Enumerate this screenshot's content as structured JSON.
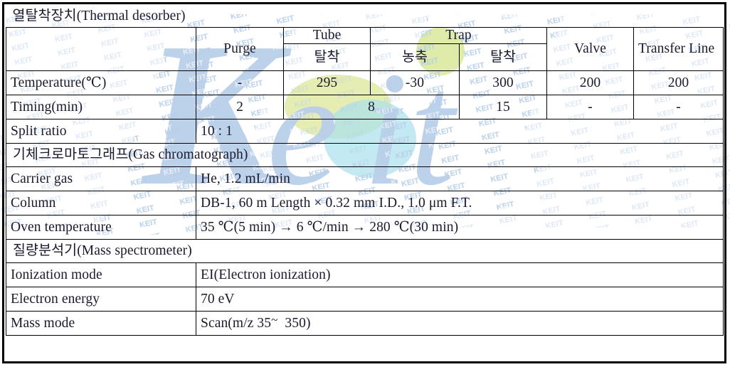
{
  "document": {
    "kind": "analytical-conditions-table",
    "watermark_text": "KEIT",
    "watermark_logo_text": "Keit",
    "colors": {
      "watermark_blue": "#b3cbe6",
      "watermark_green": "#d8e89a",
      "watermark_cyan": "#a9e0ee",
      "border": "#000000",
      "text": "#1a1a2e"
    }
  },
  "sections": {
    "thermal_desorber": "열탈착장치(Thermal desorber)",
    "gas_chromatograph": "기체크로마토그래프(Gas chromatograph)",
    "mass_spectrometer": "질량분석기(Mass spectrometer)"
  },
  "header": {
    "blank": "",
    "purge": "Purge",
    "tube": "Tube",
    "trap": "Trap",
    "valve": "Valve",
    "transfer_line": "Transfer Line",
    "tube_sub": "탈착",
    "trap_sub_1": "농축",
    "trap_sub_2": "탈착"
  },
  "rows": {
    "temperature": {
      "label": "Temperature(℃)",
      "purge": "-",
      "tube_desorb": "295",
      "trap_concentrate": "-30",
      "trap_desorb": "300",
      "valve": "200",
      "transfer_line": "200"
    },
    "timing": {
      "label": "Timing(min)",
      "purge": "2",
      "tube_and_trap_concentrate": "8",
      "trap_desorb": "15",
      "valve": "-",
      "transfer_line": "-"
    },
    "split_ratio": {
      "label": "Split ratio",
      "value": "10 : 1"
    },
    "carrier_gas": {
      "label": "Carrier gas",
      "value": "He, 1.2 mL/min"
    },
    "column": {
      "label": "Column",
      "value": "DB-1, 60 m Length × 0.32 mm I.D., 1.0 μm F.T."
    },
    "oven_temperature": {
      "label": "Oven temperature",
      "value": "35 ℃(5 min) → 6 ℃/min → 280 ℃(30 min)"
    },
    "ionization_mode": {
      "label": "Ionization mode",
      "value": "EI(Electron ionization)"
    },
    "electron_energy": {
      "label": "Electron energy",
      "value": "70 eV"
    },
    "mass_mode": {
      "label": "Mass mode",
      "value_prefix": "Scan(m/z 35",
      "value_tilde": "~",
      "value_suffix": "350)"
    }
  }
}
